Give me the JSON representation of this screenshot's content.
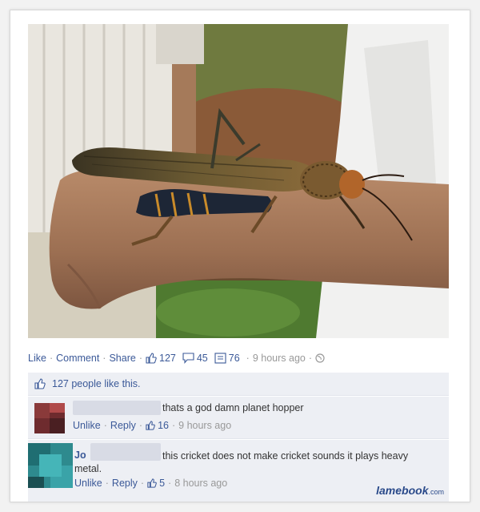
{
  "actions": {
    "like": "Like",
    "comment": "Comment",
    "share": "Share",
    "like_count": "127",
    "comment_count": "45",
    "share_count": "76",
    "time": "9 hours ago"
  },
  "likes_summary": "127 people like this.",
  "comments": [
    {
      "author": "",
      "text": "thats a god damn planet hopper",
      "unlike": "Unlike",
      "reply": "Reply",
      "likes": "16",
      "time": "9 hours ago"
    },
    {
      "author": "Jo",
      "text": "this cricket does not make cricket sounds it plays heavy",
      "text2": "metal.",
      "unlike": "Unlike",
      "reply": "Reply",
      "likes": "5",
      "time": "8 hours ago"
    }
  ],
  "watermark": {
    "main": "lamebook",
    "suffix": ".com"
  },
  "colors": {
    "link": "#3b5998",
    "comment_bg": "#edeff4"
  }
}
